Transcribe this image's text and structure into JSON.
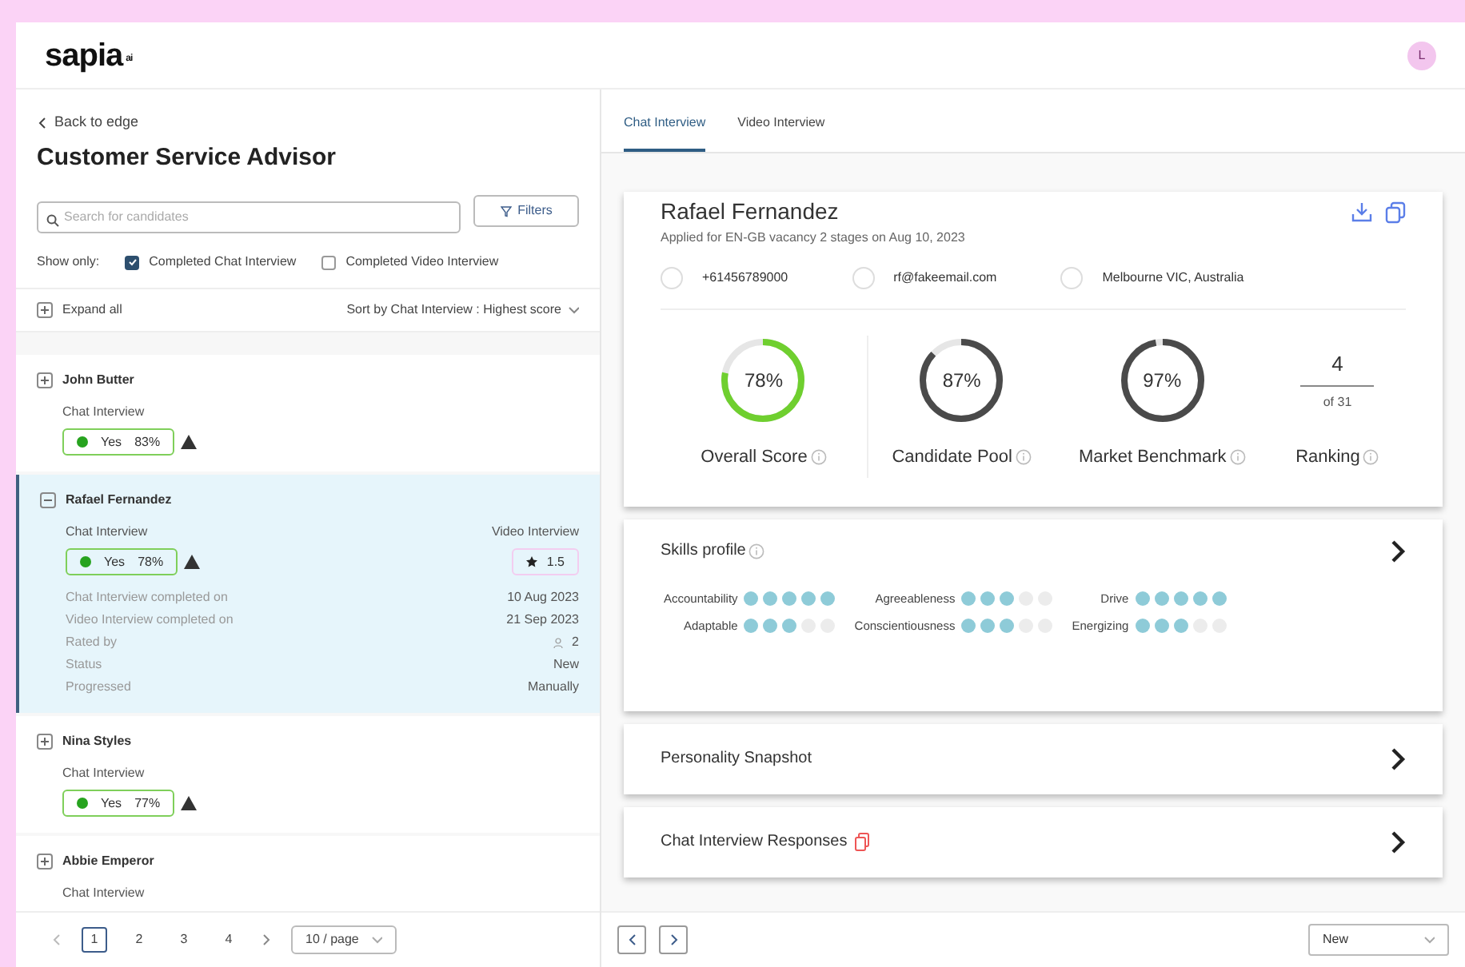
{
  "brand": {
    "logo": "sapia",
    "mark": "ai"
  },
  "user": {
    "initial": "L"
  },
  "left": {
    "back": "Back to edge",
    "title": "Customer Service Advisor",
    "search": {
      "placeholder": "Search for candidates"
    },
    "filters": "Filters",
    "show_only": "Show only:",
    "checkboxes": [
      {
        "label": "Completed Chat Interview",
        "checked": true
      },
      {
        "label": "Completed Video Interview",
        "checked": false
      }
    ],
    "expand_all": "Expand all",
    "sort": "Sort by Chat Interview : Highest score",
    "candidates": [
      {
        "name": "John Butter",
        "expanded": false,
        "selected": false,
        "chat_label": "Chat Interview",
        "result": "Yes",
        "score": "83%",
        "warning": true
      },
      {
        "name": "Rafael Fernandez",
        "expanded": true,
        "selected": true,
        "chat_label": "Chat Interview",
        "result": "Yes",
        "score": "78%",
        "warning": true,
        "video_label": "Video Interview",
        "rating": "1.5",
        "details": [
          {
            "label": "Chat Interview completed on",
            "value": "10 Aug 2023"
          },
          {
            "label": "Video Interview completed on",
            "value": "21 Sep 2023"
          },
          {
            "label": "Rated by",
            "value": "2",
            "kind": "raters"
          },
          {
            "label": "Status",
            "value": "New"
          },
          {
            "label": "Progressed",
            "value": "Manually"
          }
        ]
      },
      {
        "name": "Nina Styles",
        "expanded": false,
        "selected": false,
        "chat_label": "Chat Interview",
        "result": "Yes",
        "score": "77%",
        "warning": true
      },
      {
        "name": "Abbie Emperor",
        "expanded": false,
        "selected": false,
        "chat_label": "Chat Interview"
      }
    ],
    "pagination": {
      "pages": [
        {
          "label": "1",
          "selected": true
        },
        {
          "label": "2",
          "selected": false
        },
        {
          "label": "3",
          "selected": false
        },
        {
          "label": "4",
          "selected": false
        }
      ],
      "page_size": "10 / page"
    }
  },
  "right": {
    "tabs": [
      {
        "label": "Chat Interview",
        "selected": true
      },
      {
        "label": "Video Interview",
        "selected": false
      }
    ],
    "profile": {
      "name": "Rafael Fernandez",
      "applied": "Applied for EN-GB vacancy 2 stages on Aug 10, 2023",
      "phone": "+61456789000",
      "email": "rf@fakeemail.com",
      "location": "Melbourne VIC, Australia"
    },
    "scores": [
      {
        "label": "Overall Score",
        "value": "78%",
        "level": 0.78,
        "color": "#6fcf2f"
      },
      {
        "label": "Candidate Pool",
        "value": "87%",
        "level": 0.87,
        "color": "#4a4a4a"
      },
      {
        "label": "Market Benchmark",
        "value": "97%",
        "level": 0.97,
        "color": "#4a4a4a"
      }
    ],
    "ranking": {
      "label": "Ranking",
      "rank": "4",
      "total": "of 31"
    },
    "skills": {
      "title": "Skills profile",
      "items": [
        {
          "name": "Accountability",
          "stars": 5
        },
        {
          "name": "Agreeableness",
          "stars": 3
        },
        {
          "name": "Drive",
          "stars": 5
        },
        {
          "name": "Adaptable",
          "stars": 3
        },
        {
          "name": "Conscientiousness",
          "stars": 3
        },
        {
          "name": "Energizing",
          "stars": 3
        }
      ]
    },
    "sections": [
      {
        "title": "Personality Snapshot",
        "flag": false
      },
      {
        "title": "Chat Interview Responses",
        "flag": true
      }
    ],
    "status_select": "New"
  }
}
